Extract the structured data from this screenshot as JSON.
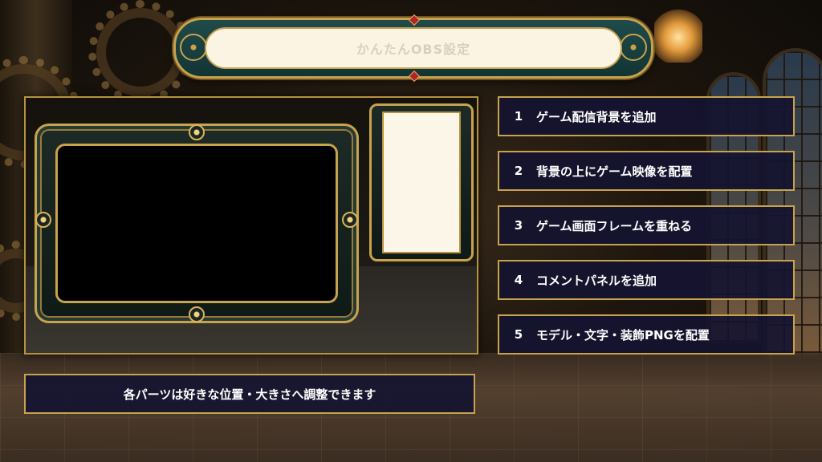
{
  "title": "かんたんOBS設定",
  "steps": [
    {
      "num": "1",
      "label": "ゲーム配信背景を追加"
    },
    {
      "num": "2",
      "label": "背景の上にゲーム映像を配置"
    },
    {
      "num": "3",
      "label": "ゲーム画面フレームを重ねる"
    },
    {
      "num": "4",
      "label": "コメントパネルを追加"
    },
    {
      "num": "5",
      "label": "モデル・文字・装飾PNGを配置"
    }
  ],
  "note": "各パーツは好きな位置・大きさへ調整できます",
  "colors": {
    "gold": "#c9a24d",
    "panel": "#151430",
    "banner_teal": "#1f4b4a",
    "gem_red": "#b0242c"
  }
}
